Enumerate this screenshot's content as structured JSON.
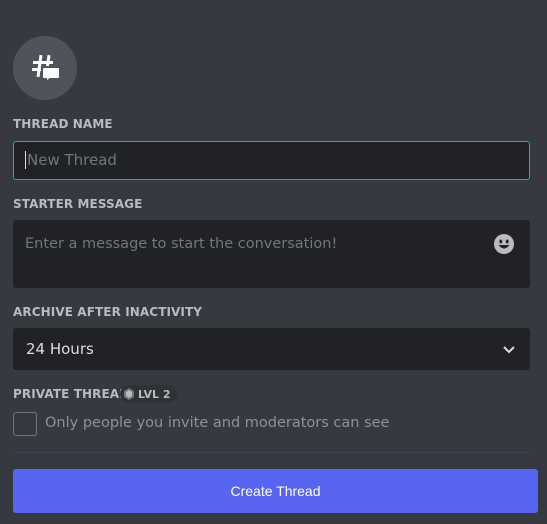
{
  "header": {
    "icon": "thread-hash-bubble-icon"
  },
  "thread_name": {
    "label": "THREAD NAME",
    "placeholder": "New Thread",
    "value": ""
  },
  "starter_message": {
    "label": "STARTER MESSAGE",
    "placeholder": "Enter a message to start the conversation!",
    "value": "",
    "emoji_icon": "smile-emoji-icon"
  },
  "archive": {
    "label": "ARCHIVE AFTER INACTIVITY",
    "selected": "24 Hours",
    "chevron_icon": "chevron-down-icon"
  },
  "private_thread": {
    "label": "PRIVATE THREAD",
    "badge": "LVL 2",
    "badge_icon": "boost-gem-icon",
    "checkbox_label": "Only people you invite and moderators can see",
    "checked": false
  },
  "actions": {
    "create_label": "Create Thread"
  },
  "colors": {
    "background": "#36393f",
    "input_bg": "#202225",
    "focus_border": "#00aff4",
    "primary_button": "#5865f2",
    "label": "#b9bbbe",
    "placeholder": "#72767d"
  }
}
